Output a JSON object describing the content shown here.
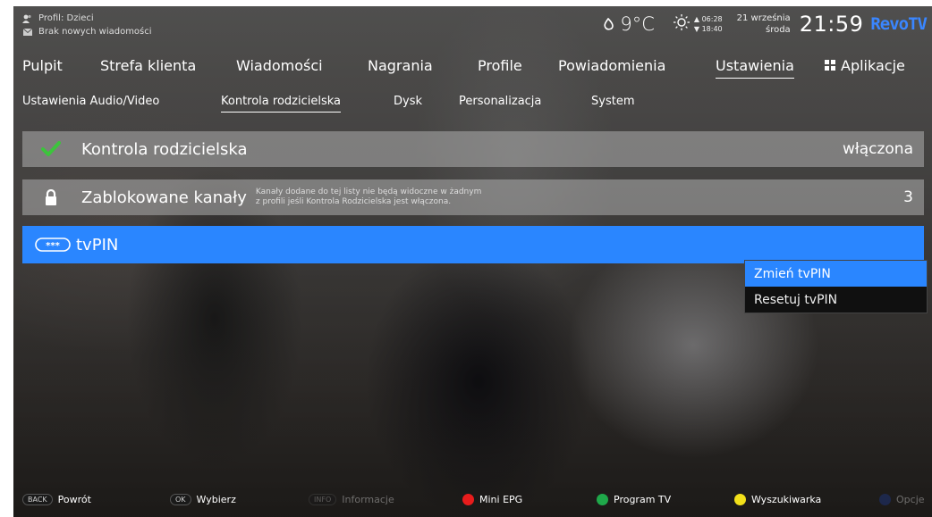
{
  "status": {
    "profile": "Profil: Dzieci",
    "messages": "Brak nowych wiadomości",
    "temperature": "9°C",
    "sunrise": "06:28",
    "sunset": "18:40",
    "date": "21 września",
    "weekday": "środa",
    "time": "21:59",
    "brand": "RevoTV"
  },
  "nav": {
    "tabs": [
      "Pulpit",
      "Strefa klienta",
      "Wiadomości",
      "Nagrania",
      "Profile",
      "Powiadomienia",
      "Ustawienia",
      "Aplikacje"
    ],
    "active": "Ustawienia"
  },
  "subnav": {
    "tabs": [
      "Ustawienia Audio/Video",
      "Kontrola rodzicielska",
      "Dysk",
      "Personalizacja",
      "System"
    ],
    "active": "Kontrola rodzicielska"
  },
  "items": [
    {
      "label": "Kontrola rodzicielska",
      "value": "włączona",
      "icon": "check-icon"
    },
    {
      "label": "Zablokowane kanały",
      "value": "3",
      "icon": "lock-icon",
      "description_line1": "Kanały dodane do tej listy nie będą widoczne w żadnym",
      "description_line2": "z profili jeśli Kontrola Rodzicielska jest włączona."
    },
    {
      "label": "tvPIN",
      "icon": "pin-icon",
      "icon_text": "***"
    }
  ],
  "popup": {
    "options": [
      "Zmień tvPIN",
      "Resetuj tvPIN"
    ],
    "active": "Zmień tvPIN"
  },
  "hints": [
    {
      "key": "BACK",
      "label": "Powrót"
    },
    {
      "key": "OK",
      "label": "Wybierz"
    },
    {
      "key": "INFO",
      "label": "Informacje"
    },
    {
      "color": "#e81c1c",
      "label": "Mini EPG"
    },
    {
      "color": "#1fa84a",
      "label": "Program TV"
    },
    {
      "color": "#f2e01a",
      "label": "Wyszukiwarka"
    },
    {
      "color": "#1d3fa8",
      "label": "Opcje"
    }
  ],
  "colors": {
    "accent": "#2a86ff"
  }
}
